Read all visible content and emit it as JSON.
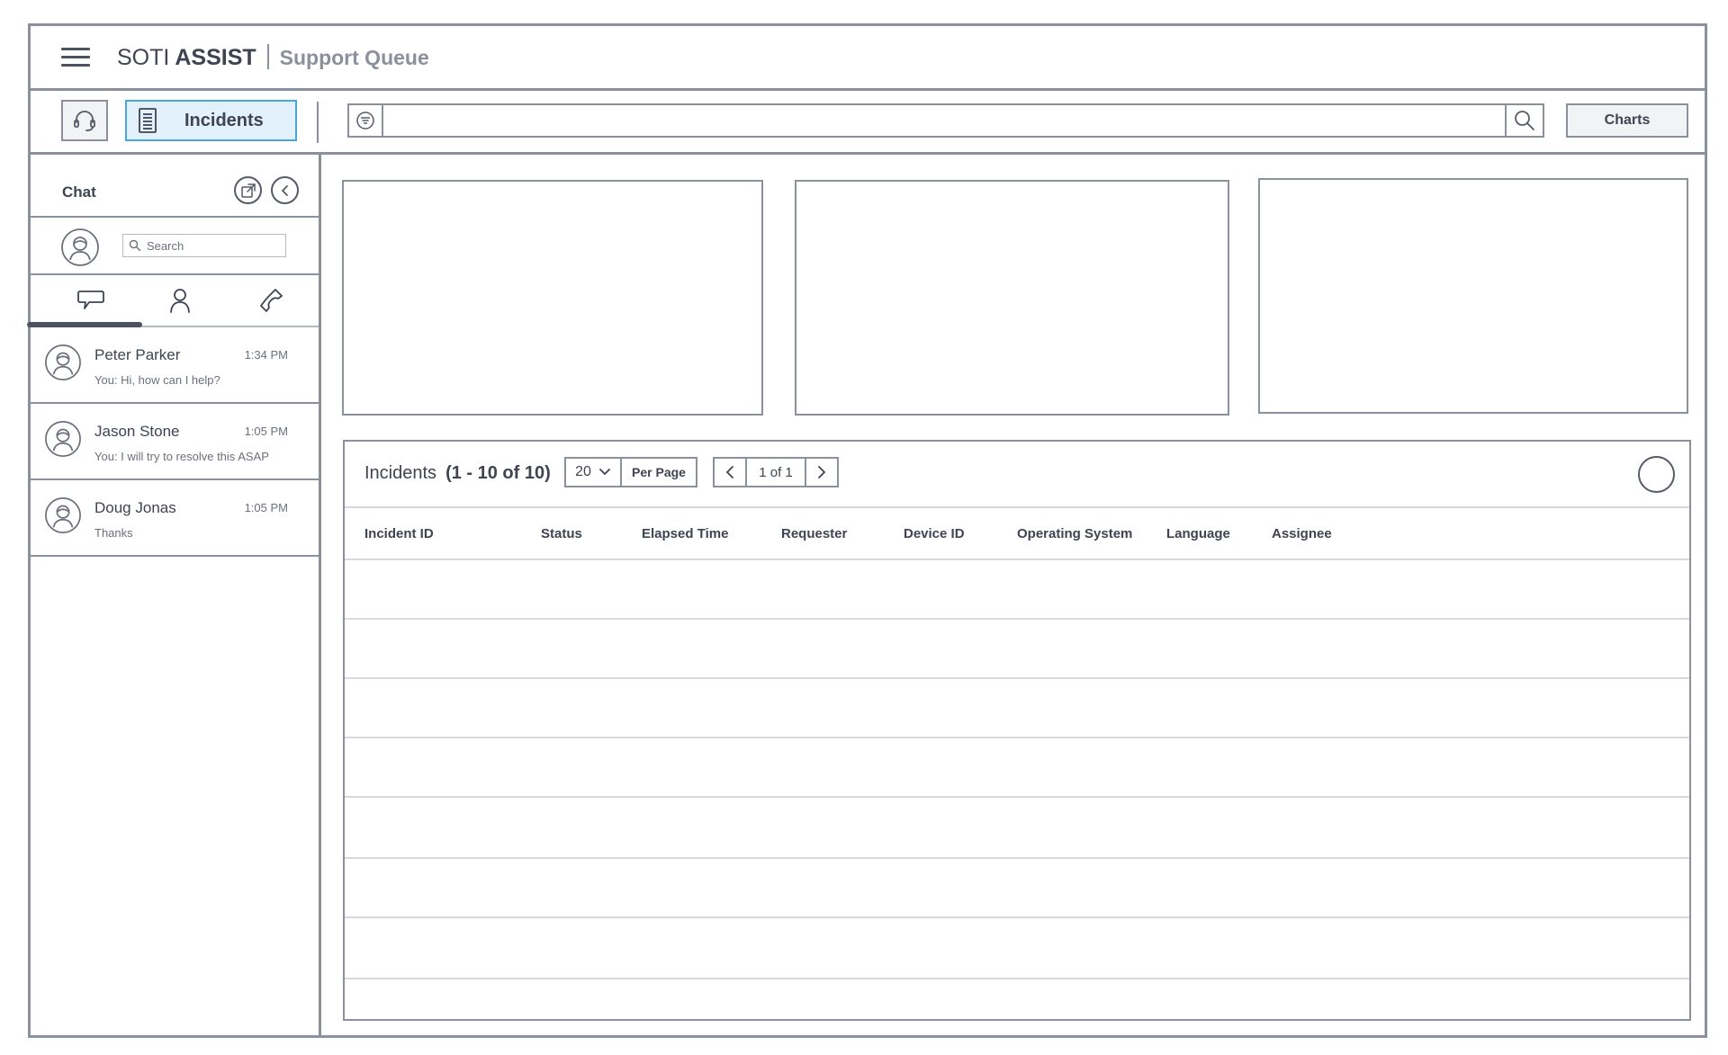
{
  "header": {
    "brand_light": "SOTI",
    "brand_bold": "ASSIST",
    "section": "Support Queue"
  },
  "toolbar": {
    "incidents_label": "Incidents",
    "charts_label": "Charts",
    "search_value": ""
  },
  "chat": {
    "title": "Chat",
    "search_placeholder": "Search",
    "conversations": [
      {
        "name": "Peter Parker",
        "time": "1:34 PM",
        "message": "You: Hi, how can I help?"
      },
      {
        "name": "Jason Stone",
        "time": "1:05 PM",
        "message": "You: I will try to resolve this ASAP"
      },
      {
        "name": "Doug Jonas",
        "time": "1:05 PM",
        "message": "Thanks"
      }
    ]
  },
  "incidents": {
    "title": "Incidents",
    "count": "(1 - 10 of 10)",
    "per_page_value": "20",
    "per_page_label": "Per Page",
    "page_indicator": "1 of 1",
    "columns": [
      "Incident ID",
      "Status",
      "Elapsed Time",
      "Requester",
      "Device ID",
      "Operating System",
      "Language",
      "Assignee"
    ]
  },
  "icons": {
    "menu": "hamburger-menu-icon",
    "support": "headset-icon",
    "incidents": "document-list-icon",
    "filter": "filter-icon",
    "search": "magnifier-icon",
    "popout": "external-link-icon",
    "collapse": "chevron-left-icon",
    "chats": "speech-bubble-icon",
    "contacts": "person-icon",
    "calls": "phone-icon"
  }
}
